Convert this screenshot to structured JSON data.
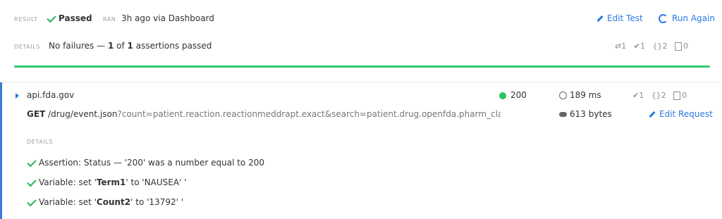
{
  "result": {
    "label": "RESULT",
    "status": "Passed",
    "ran_label": "RAN",
    "ran_value": "3h ago via Dashboard",
    "edit_test": "Edit Test",
    "run_again": "Run Again"
  },
  "details": {
    "label": "DETAILS",
    "summary_prefix": "No failures  —",
    "passed_count": "1",
    "of_text": "of",
    "total_count": "1",
    "suffix": "assertions passed",
    "counts": {
      "requests": "1",
      "assertions": "1",
      "variables": "2",
      "scripts": "0"
    }
  },
  "progress": {
    "passed_fraction": 1.0,
    "color": "#2ecc71"
  },
  "request": {
    "host": "api.fda.gov",
    "method": "GET",
    "path": "/drug/event.json",
    "query": "?count=patient.reaction.reactionmeddrapt.exact&search=patient.drug.openfda.pharm_class_epc:\"r",
    "status_code": "200",
    "time": "189 ms",
    "size": "613 bytes",
    "edit_request": "Edit Request",
    "counts": {
      "assertions": "1",
      "variables": "2",
      "scripts": "0"
    }
  },
  "request_details": {
    "label": "DETAILS",
    "items": [
      {
        "prefix": "Assertion: Status  —  '200' was a number equal to 200",
        "bold": "",
        "suffix": ""
      },
      {
        "prefix": "Variable: set '",
        "bold": "Term1",
        "suffix": "' to 'NAUSEA' '"
      },
      {
        "prefix": "Variable: set '",
        "bold": "Count2",
        "suffix": "' to '13792' '"
      }
    ]
  },
  "colors": {
    "accent": "#2a7ae2",
    "success": "#27b35a",
    "progress": "#2ecc71"
  },
  "icons": [
    "check-icon",
    "pencil-icon",
    "refresh-icon",
    "swap-icon",
    "braces-icon",
    "document-icon",
    "clock-icon",
    "cloud-icon",
    "caret-right-icon",
    "status-dot-icon"
  ]
}
